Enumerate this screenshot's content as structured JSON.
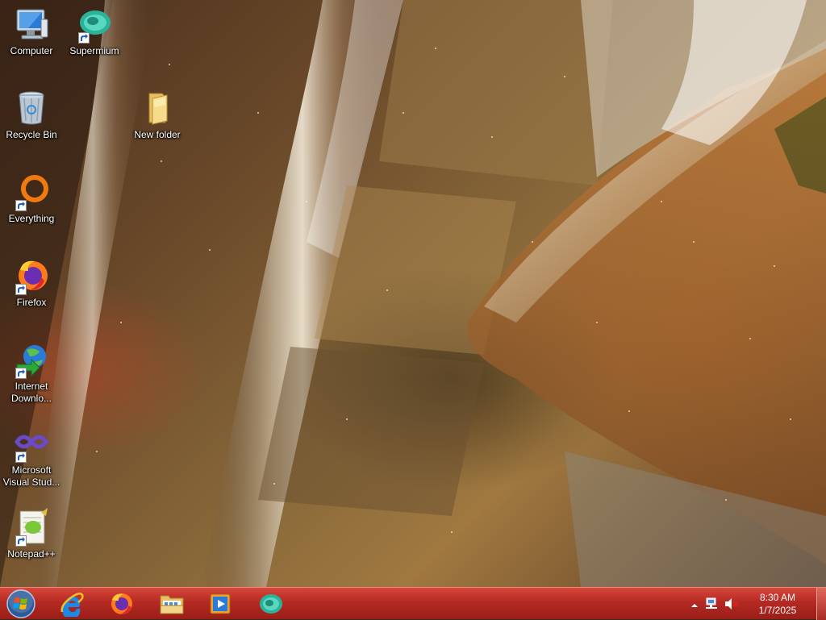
{
  "desktop": {
    "icons": [
      {
        "label": "Computer",
        "icon": "computer-icon",
        "shortcut": false
      },
      {
        "label": "Supermium",
        "icon": "supermium-icon",
        "shortcut": true
      },
      {
        "label": "Recycle Bin",
        "icon": "recycle-bin-icon",
        "shortcut": false
      },
      {
        "label": "New folder",
        "icon": "folder-icon",
        "shortcut": false
      },
      {
        "label": "Everything",
        "icon": "everything-icon",
        "shortcut": true
      },
      {
        "label": "Firefox",
        "icon": "firefox-icon",
        "shortcut": true
      },
      {
        "label": "Internet Downlo...",
        "icon": "internet-download-manager-icon",
        "shortcut": true
      },
      {
        "label": "Microsoft Visual Stud...",
        "icon": "visual-studio-icon",
        "shortcut": true
      },
      {
        "label": "Notepad++",
        "icon": "notepad-plus-plus-icon",
        "shortcut": true
      }
    ]
  },
  "taskbar": {
    "pinned": [
      {
        "icon": "internet-explorer-icon"
      },
      {
        "icon": "firefox-icon"
      },
      {
        "icon": "file-explorer-icon"
      },
      {
        "icon": "media-player-icon"
      },
      {
        "icon": "supermium-icon"
      }
    ],
    "tray": {
      "show_hidden_icon": "chevron-up-icon",
      "network_icon": "network-icon",
      "volume_icon": "volume-muted-icon",
      "time": "8:30 AM",
      "date": "1/7/2025"
    },
    "accent": "#b42a23"
  }
}
